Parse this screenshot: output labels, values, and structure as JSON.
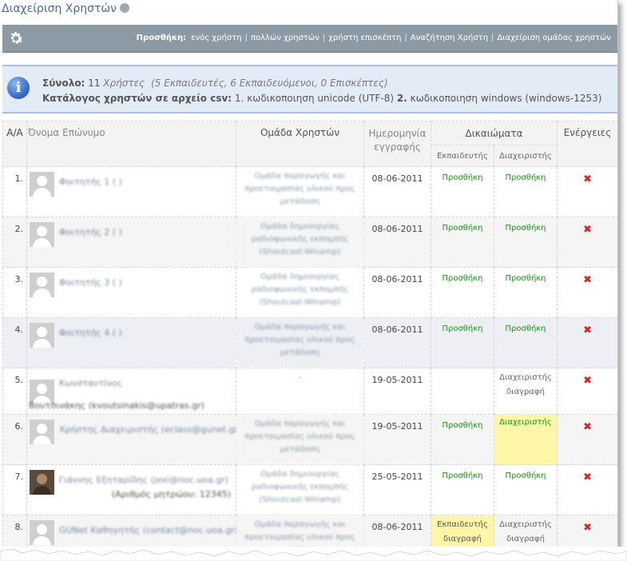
{
  "page": {
    "title": "Διαχείριση Χρηστών"
  },
  "toolbar": {
    "add_label": "Προσθήκη:",
    "links": [
      "ενός χρήστη",
      "πολλών χρηστών",
      "χρήστη επισκέπτη",
      "Αναζήτηση Χρήστη",
      "Διαχείριση ομάδας χρηστών"
    ],
    "separator": "|"
  },
  "info": {
    "total_label": "Σύνολο:",
    "total_count": "11",
    "total_users": "Χρήστες",
    "total_breakdown": "(5 Εκπαιδευτές, 6 Εκπαιδευόμενοι, 0 Επισκέπτες)",
    "csv_label": "Κατάλογος χρηστών σε αρχείο csv:",
    "csv_opt1_num": "1.",
    "csv_opt1": "κωδικοποιηση unicode (UTF-8)",
    "csv_opt2_num": "2.",
    "csv_opt2": "κωδικοποιηση windows (windows-1253)"
  },
  "table": {
    "headers": {
      "aa": "Α/Α",
      "name": "Όνομα Επώνυμο",
      "group": "Ομάδα Χρηστών",
      "date": "Ημερομηνία εγγραφής",
      "rights": "Δικαιώματα",
      "teacher": "Εκπαιδευτής",
      "admin": "Διαχειριστής",
      "actions": "Ενέργειες"
    },
    "rows": [
      {
        "num": "1.",
        "name": "Φοιτητής 1 ( )",
        "group": "Ομάδα παραγωγής και προετοιμασίας υλικού προς μετάδοση",
        "date": "08-06-2011",
        "teacher": "Προσθήκη",
        "admin": "Προσθήκη"
      },
      {
        "num": "2.",
        "name": "Φοιτητής 2 ( )",
        "group": "Ομάδα δημιουργίας ραδιοφωνικής εκπομπής (Shoutcast-Winamp)",
        "date": "08-06-2011",
        "teacher": "Προσθήκη",
        "admin": "Προσθήκη"
      },
      {
        "num": "3.",
        "name": "Φοιτητής 3 ( )",
        "group": "Ομάδα δημιουργίας ραδιοφωνικής εκπομπής (Shoutcast-Winamp)",
        "date": "08-06-2011",
        "teacher": "Προσθήκη",
        "admin": "Προσθήκη"
      },
      {
        "num": "4.",
        "name": "Φοιτητής 4 ( )",
        "group": "Ομάδα παραγωγής και προετοιμασίας υλικού προς μετάδοση",
        "date": "08-06-2011",
        "teacher": "Προσθήκη",
        "admin": "Προσθήκη"
      },
      {
        "num": "5.",
        "name": "Κωνσταντίνος",
        "name2": "Βουτσινάκης (kvoutsinakis@upatras.gr)",
        "group": "-",
        "date": "19-05-2011",
        "teacher": "",
        "admin": "Διαχειριστής",
        "admin2": "διαγραφή"
      },
      {
        "num": "6.",
        "name": "Χρήστης Διαχειριστής (eclass@gunet.gr)",
        "group": "Ομάδα παραγωγής και προετοιμασίας υλικού προς μετάδοση",
        "date": "19-05-2011",
        "teacher": "Προσθήκη",
        "admin": "Διαχειριστής"
      },
      {
        "num": "7.",
        "name": "Γιάννης Εξηταρίδης (jexi@noc.uoa.gr)",
        "name2": "(Αριθμός μητρώου: 12345)",
        "group": "Ομάδα δημιουργίας ραδιοφωνικής εκπομπής (Shoutcast-Winamp)",
        "date": "25-05-2011",
        "teacher": "Προσθήκη",
        "admin": "Προσθήκη"
      },
      {
        "num": "8.",
        "name": "GUNet Καθηγητής (contact@noc.uoa.gr)",
        "group": "Ομάδα παραγωγής και προετοιμασίας υλικού προς μετάδοση",
        "date": "08-06-2011",
        "teacher": "Εκπαιδευτής",
        "teacher2": "διαγραφή",
        "admin": "Διαχειριστής",
        "admin2": "διαγραφή"
      }
    ]
  },
  "colors": {
    "toolbar": "#8c9aa5",
    "info_bg": "#e3ebf7",
    "link_green": "#119b11",
    "delete_red": "#dd2222",
    "highlight_yellow": "#fff7a8"
  },
  "icons": {
    "settings": "gear-icon",
    "info": "info-icon",
    "delete": "delete-icon",
    "avatar": "avatar-icon"
  }
}
